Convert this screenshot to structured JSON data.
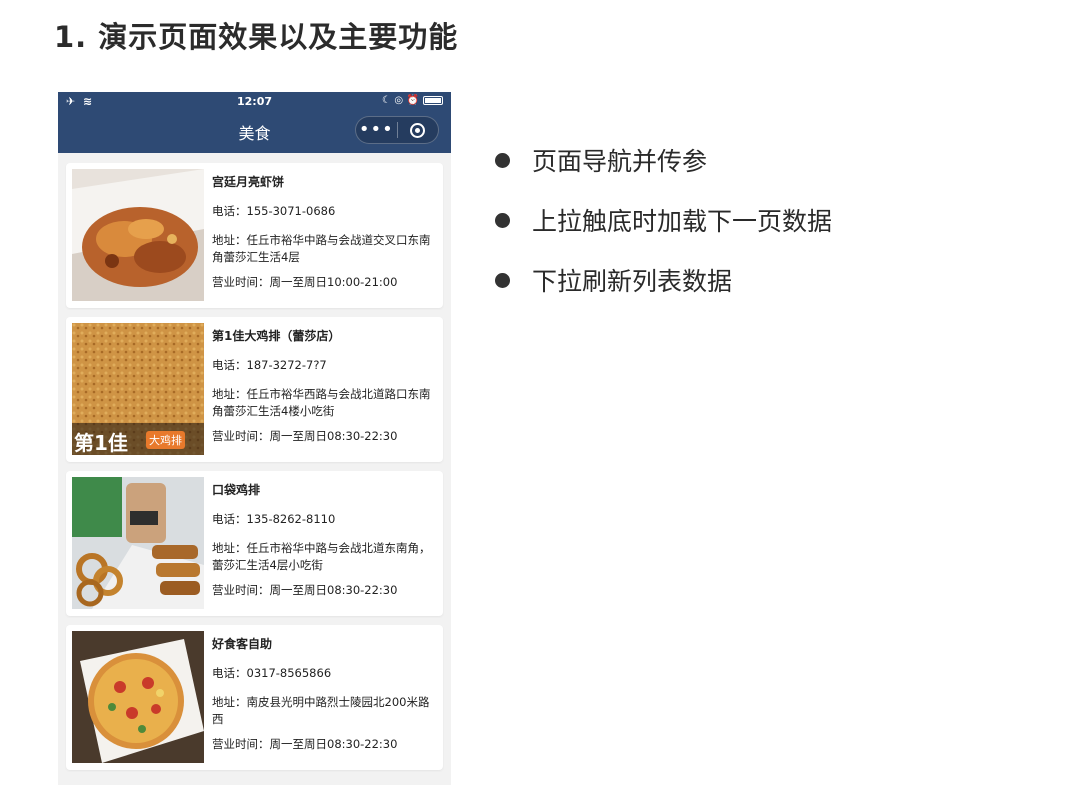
{
  "slide": {
    "title": "1. 演示页面效果以及主要功能"
  },
  "phone": {
    "status": {
      "left": "✈ ≋",
      "time": "12:07",
      "right": "☾ ◎ ⏰"
    },
    "navbar": {
      "title": "美食",
      "more": "•••"
    }
  },
  "shops": [
    {
      "name": "宫廷月亮虾饼",
      "phone": "电话：155-3071-0686",
      "address": "地址：任丘市裕华中路与会战道交叉口东南角蕾莎汇生活4层",
      "hours": "营业时间：周一至周日10:00-21:00"
    },
    {
      "name": "第1佳大鸡排（蕾莎店）",
      "phone": "电话：187-3272-7?7",
      "address": "地址：任丘市裕华西路与会战北道路口东南角蕾莎汇生活4楼小吃街",
      "hours": "营业时间：周一至周日08:30-22:30",
      "logo": "第1佳",
      "logo_tag": "大鸡排"
    },
    {
      "name": "口袋鸡排",
      "phone": "电话：135-8262-8110",
      "address": "地址：任丘市裕华中路与会战北道东南角，蕾莎汇生活4层小吃街",
      "hours": "营业时间：周一至周日08:30-22:30"
    },
    {
      "name": "好食客自助",
      "phone": "电话：0317-8565866",
      "address": "地址：南皮县光明中路烈士陵园北200米路西",
      "hours": "营业时间：周一至周日08:30-22:30"
    }
  ],
  "features": [
    "页面导航并传参",
    "上拉触底时加载下一页数据",
    "下拉刷新列表数据"
  ]
}
